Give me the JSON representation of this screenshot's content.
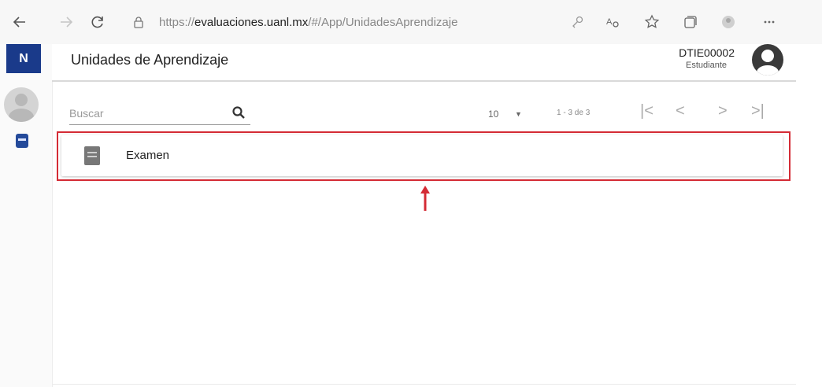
{
  "browser": {
    "url_prefix": "https://",
    "url_host": "evaluaciones.uanl.mx",
    "url_path": "/#/App/UnidadesAprendizaje"
  },
  "app": {
    "logo_letter": "N",
    "page_title": "Unidades de Aprendizaje",
    "user": {
      "id": "DTIE00002",
      "role": "Estudiante"
    }
  },
  "toolbar": {
    "search_placeholder": "Buscar",
    "page_size": "10",
    "page_range": "1 - 3 de 3"
  },
  "units": [
    {
      "label": "Examen"
    }
  ],
  "colors": {
    "highlight": "#d42b35",
    "brand": "#1a3a8a"
  }
}
